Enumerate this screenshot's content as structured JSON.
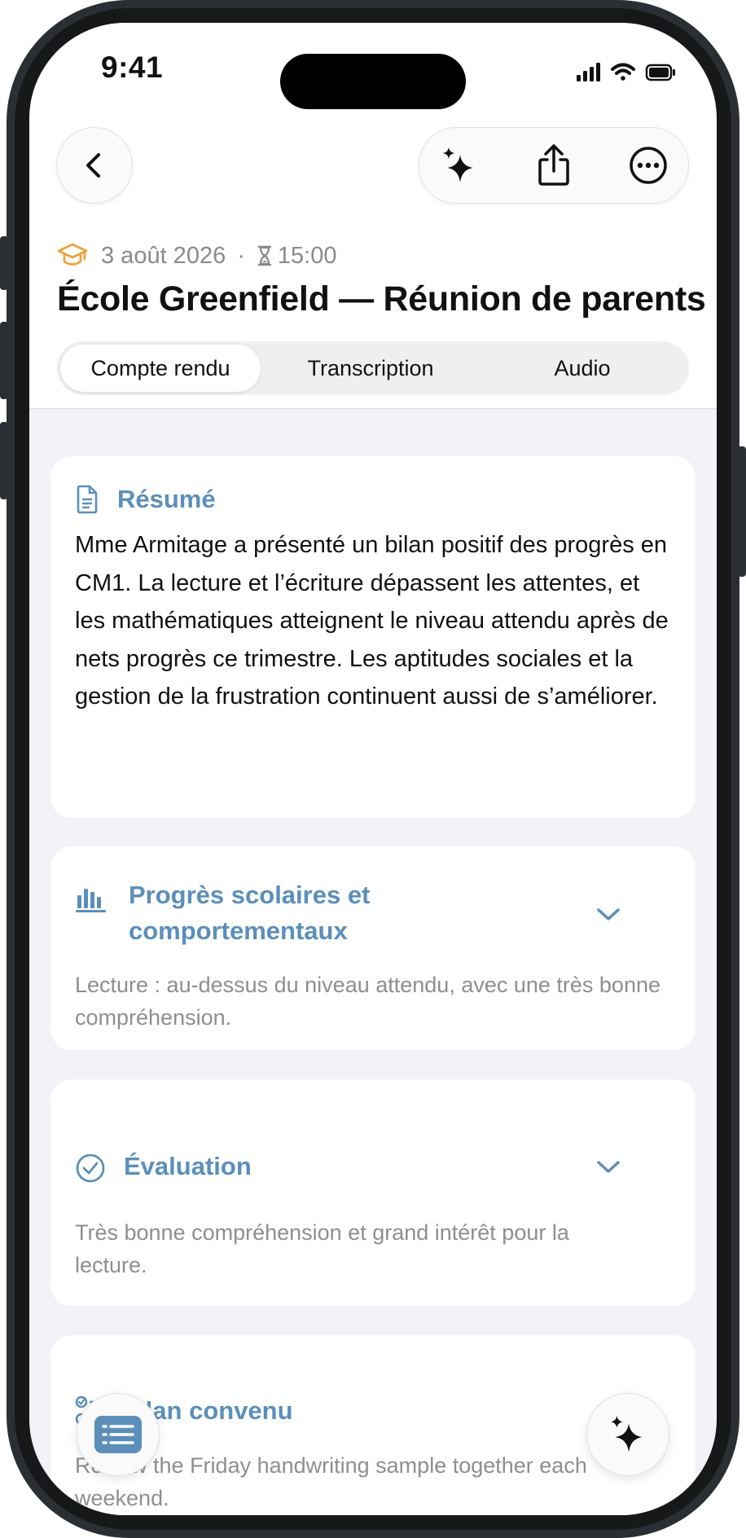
{
  "status_bar": {
    "time": "9:41"
  },
  "meta": {
    "date": "3 août 2026",
    "separator": "·",
    "time": "15:00"
  },
  "title": "École Greenfield — Réunion de parents",
  "tabs": [
    {
      "label": "Compte rendu",
      "active": true
    },
    {
      "label": "Transcription",
      "active": false
    },
    {
      "label": "Audio",
      "active": false
    }
  ],
  "summary": {
    "heading": "Résumé",
    "text": "Mme Armitage a présenté un bilan positif des progrès en CM1. La lecture et l’écriture dépassent les attentes, et les mathématiques atteignent le niveau attendu après de nets progrès ce trimestre. Les aptitudes sociales et la gestion de la frustration continuent aussi de s’améliorer."
  },
  "sections": [
    {
      "heading": "Progrès scolaires et comportementaux",
      "preview": "Lecture : au-dessus du niveau attendu, avec une très bonne compréhension."
    },
    {
      "heading": "Évaluation",
      "preview": "Très bonne compréhension et grand intérêt pour la lecture."
    },
    {
      "heading": "Plan convenu",
      "preview": "Review the Friday handwriting sample together each weekend."
    }
  ],
  "colors": {
    "accent": "#5b8fba",
    "school_icon": "#f0a23c",
    "background": "#f2f2f7"
  },
  "icons": {
    "back": "chevron-left-icon",
    "ai": "sparkles-icon",
    "share": "share-icon",
    "more": "ellipsis-circle-icon",
    "school": "graduation-cap-icon",
    "hourglass": "hourglass-icon",
    "summary": "document-icon",
    "progress": "bar-chart-icon",
    "evaluation": "check-circle-icon",
    "plan": "checklist-icon",
    "fab_left": "list-icon",
    "fab_right": "sparkles-icon"
  }
}
